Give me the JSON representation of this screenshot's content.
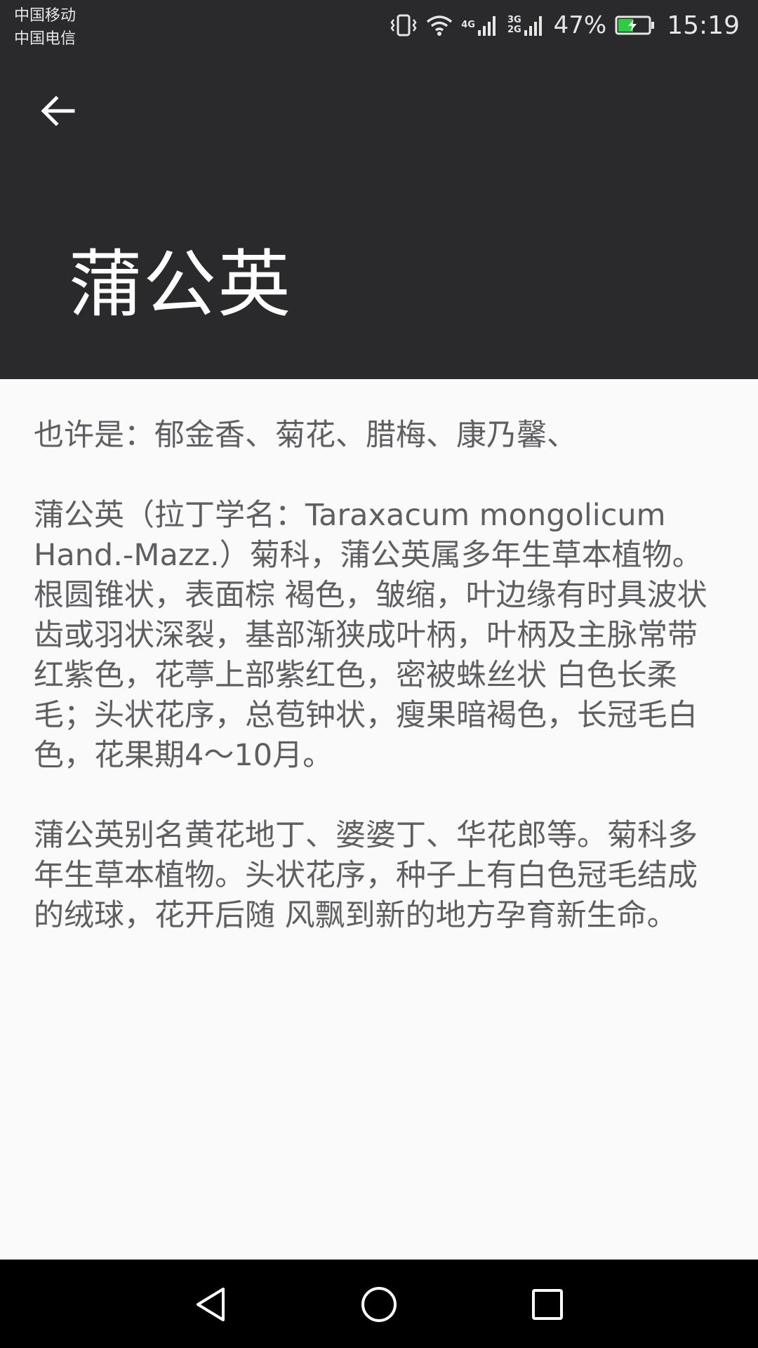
{
  "status_bar": {
    "carrier_1": "中国移动",
    "carrier_2": "中国电信",
    "network_1": [
      "4G"
    ],
    "network_2": [
      "3G",
      "2G"
    ],
    "battery_percent": "47%",
    "time": "15:19",
    "icons": [
      "vibrate-icon",
      "wifi-icon",
      "signal-4g-icon",
      "signal-3g2g-icon",
      "battery-charging-icon"
    ]
  },
  "toolbar": {
    "back_icon": "arrow-left-icon"
  },
  "title": "蒲公英",
  "content": {
    "maybe": "也许是：郁金香、菊花、腊梅、康乃馨、",
    "paragraph_1": "蒲公英（拉丁学名：Taraxacum mongolicum Hand.-Mazz.）菊科，蒲公英属多年生草本植物。根圆锥状，表面棕 褐色，皱缩，叶边缘有时具波状齿或羽状深裂，基部渐狭成叶柄，叶柄及主脉常带红紫色，花葶上部紫红色，密被蛛丝状 白色长柔毛；头状花序，总苞钟状，瘦果暗褐色，长冠毛白色，花果期4～10月。",
    "paragraph_2": " 蒲公英别名黄花地丁、婆婆丁、华花郎等。菊科多年生草本植物。头状花序，种子上有白色冠毛结成的绒球，花开后随 风飘到新的地方孕育新生命。"
  },
  "nav_bar": {
    "icons": [
      "nav-back-icon",
      "nav-home-icon",
      "nav-recent-icon"
    ]
  },
  "colors": {
    "header_bg": "#2a2a2d",
    "content_bg": "#fafafa",
    "content_text": "#5f5f63",
    "battery_green": "#2ecc40",
    "nav_bg": "#000000"
  }
}
